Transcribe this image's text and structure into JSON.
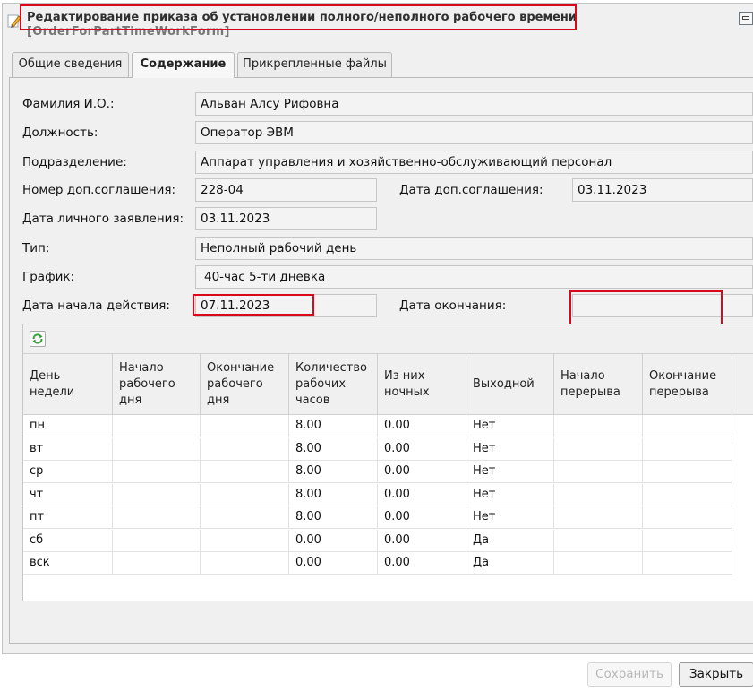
{
  "window": {
    "title": "Редактирование приказа об установлении полного/неполного рабочего времени",
    "subtitle": "[OrderForPartTimeWorkForm]"
  },
  "tabs": [
    {
      "label": "Общие сведения",
      "active": false
    },
    {
      "label": "Содержание",
      "active": true
    },
    {
      "label": "Прикрепленные файлы",
      "active": false
    }
  ],
  "form": {
    "fio_label": "Фамилия И.О.:",
    "fio_value": "Альван Алсу Рифовна",
    "position_label": "Должность:",
    "position_value": "Оператор ЭВМ",
    "department_label": "Подразделение:",
    "department_value": "Аппарат управления и хозяйственно-обслуживающий персонал",
    "agreement_no_label": "Номер доп.соглашения:",
    "agreement_no_value": "228-04",
    "agreement_date_label": "Дата доп.соглашения:",
    "agreement_date_value": "03.11.2023",
    "application_date_label": "Дата личного заявления:",
    "application_date_value": "03.11.2023",
    "type_label": "Тип:",
    "type_value": "Неполный рабочий день",
    "schedule_label": "График:",
    "schedule_value": "40-час 5-ти дневка",
    "start_date_label": "Дата начала действия:",
    "start_date_value": "07.11.2023",
    "end_date_label": "Дата окончания:",
    "end_date_value": ""
  },
  "grid": {
    "columns": [
      "День недели",
      "Начало рабочего дня",
      "Окончание рабочего дня",
      "Количество рабочих часов",
      "Из них ночных",
      "Выходной",
      "Начало перерыва",
      "Окончание перерыва"
    ],
    "rows": [
      [
        "пн",
        "",
        "",
        "8.00",
        "0.00",
        "Нет",
        "",
        ""
      ],
      [
        "вт",
        "",
        "",
        "8.00",
        "0.00",
        "Нет",
        "",
        ""
      ],
      [
        "ср",
        "",
        "",
        "8.00",
        "0.00",
        "Нет",
        "",
        ""
      ],
      [
        "чт",
        "",
        "",
        "8.00",
        "0.00",
        "Нет",
        "",
        ""
      ],
      [
        "пт",
        "",
        "",
        "8.00",
        "0.00",
        "Нет",
        "",
        ""
      ],
      [
        "сб",
        "",
        "",
        "0.00",
        "0.00",
        "Да",
        "",
        ""
      ],
      [
        "вск",
        "",
        "",
        "0.00",
        "0.00",
        "Да",
        "",
        ""
      ]
    ]
  },
  "buttons": {
    "save_label": "Сохранить",
    "close_label": "Закрыть"
  },
  "colors": {
    "highlight": "#d9091b",
    "refresh_icon": "#3a9d3a"
  }
}
